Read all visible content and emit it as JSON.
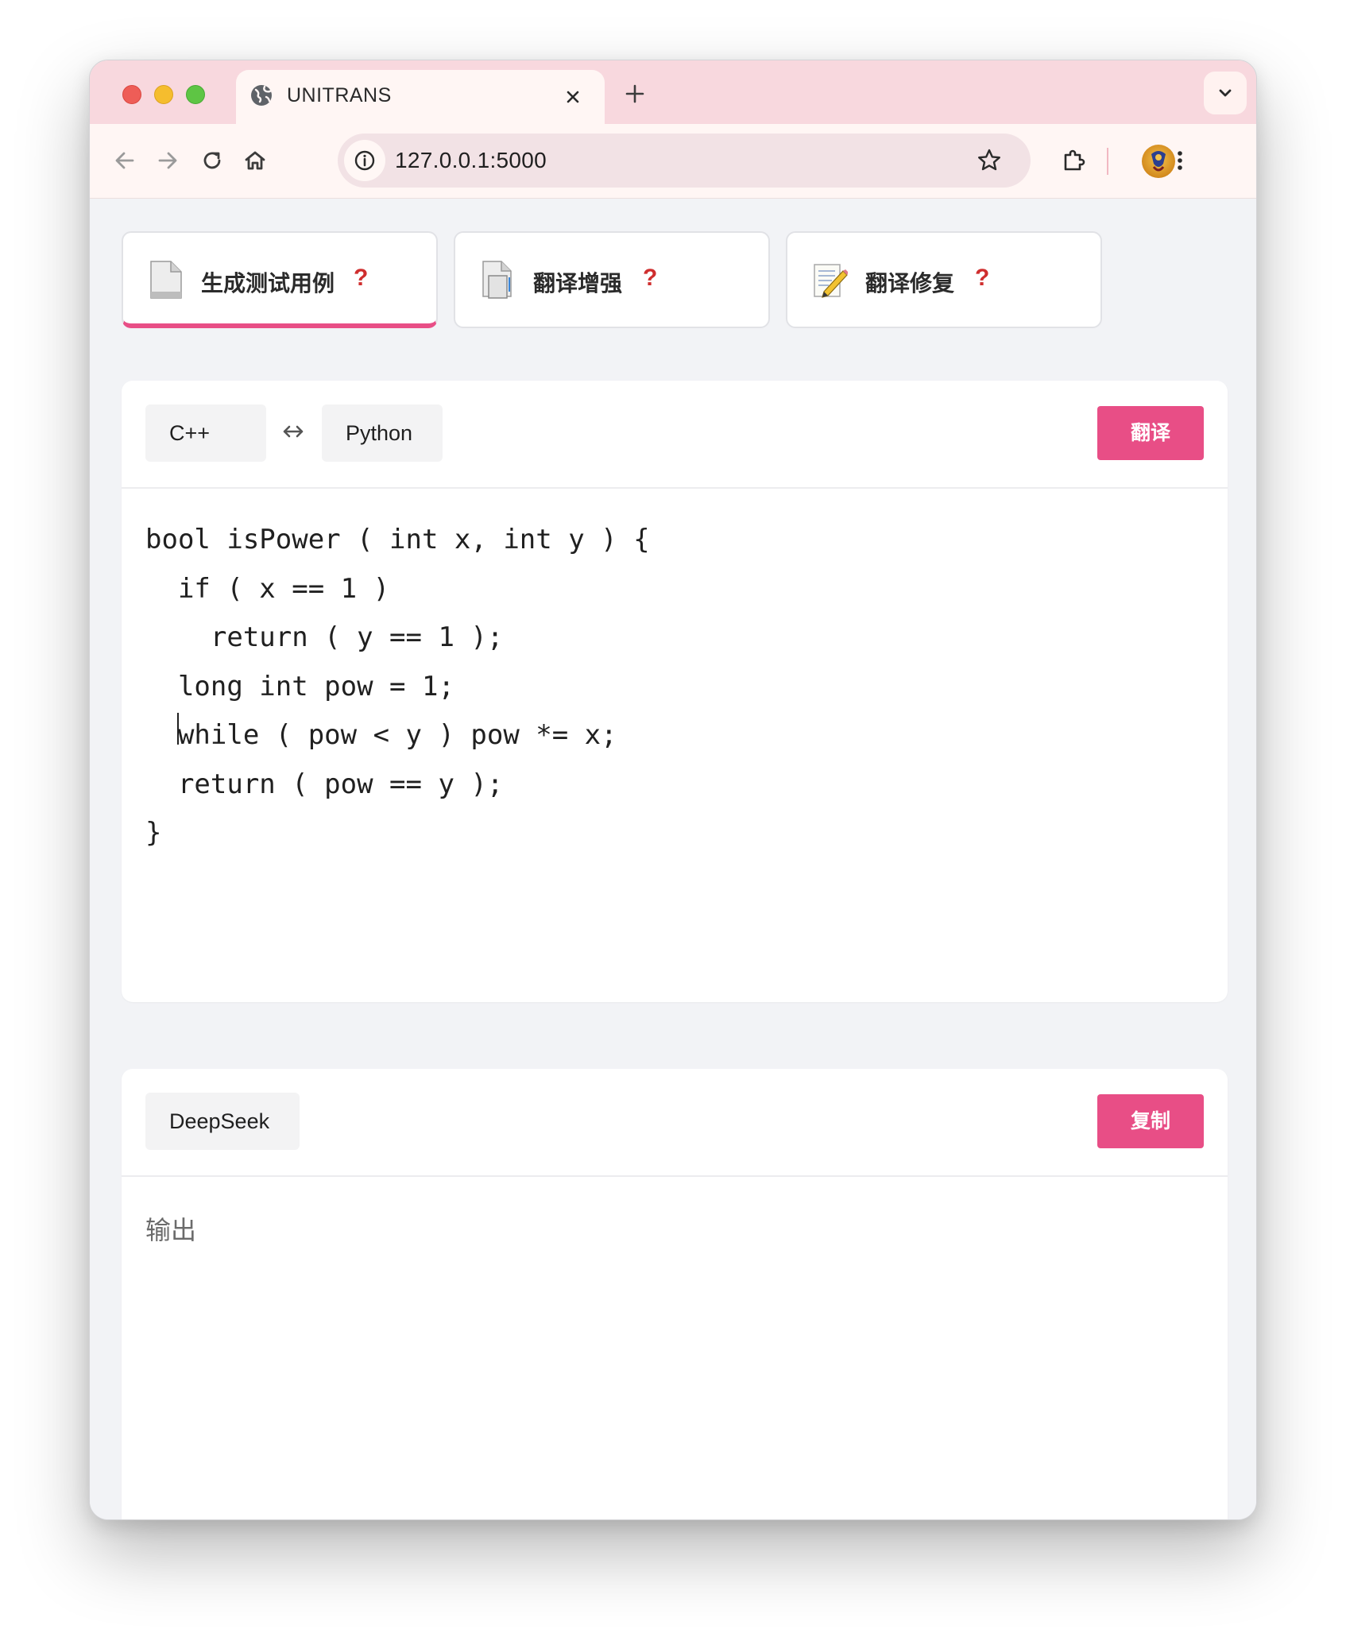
{
  "browser": {
    "tab_title": "UNITRANS",
    "url": "127.0.0.1:5000"
  },
  "features": [
    {
      "label": "生成测试用例",
      "help": "?",
      "active": true
    },
    {
      "label": "翻译增强",
      "help": "?",
      "active": false
    },
    {
      "label": "翻译修复",
      "help": "?",
      "active": false
    }
  ],
  "translate": {
    "source_language": "C++",
    "target_language": "Python",
    "button_label": "翻译",
    "code_lines": [
      "bool isPower ( int x, int y ) {",
      "  if ( x == 1 )",
      "    return ( y == 1 );",
      "  long int pow = 1;",
      "  while ( pow < y ) pow *= x;",
      "  return ( pow == y );",
      "}"
    ]
  },
  "output": {
    "model": "DeepSeek",
    "button_label": "复制",
    "placeholder": "输出"
  },
  "colors": {
    "accent": "#e84e86",
    "help": "#cf2e2e",
    "tab_strip": "#f8d8de",
    "page_bg": "#f2f3f6"
  }
}
